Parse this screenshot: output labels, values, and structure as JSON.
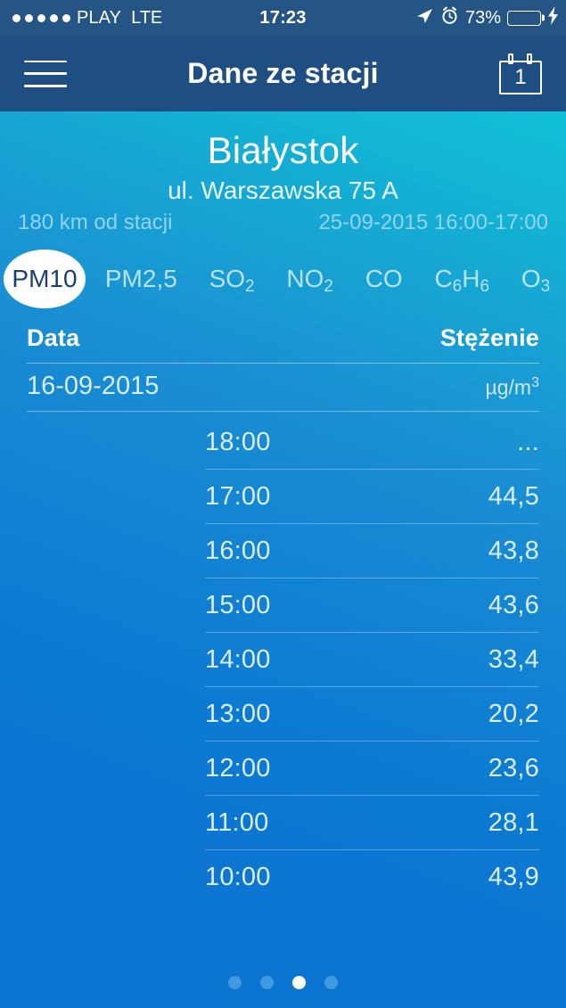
{
  "status_bar": {
    "signal_dots": 5,
    "carrier": "PLAY",
    "network": "LTE",
    "time": "17:23",
    "location_icon": "location-arrow-icon",
    "alarm_icon": "alarm-clock-icon",
    "battery_percent": "73%",
    "battery_level": 73,
    "battery_color": "#4cd964",
    "charging_icon": "lightning-bolt-icon"
  },
  "navbar": {
    "menu_icon": "hamburger-menu-icon",
    "title": "Dane ze stacji",
    "calendar_icon": "calendar-icon",
    "calendar_day": "1",
    "background": "#1f4f82"
  },
  "station": {
    "city": "Białystok",
    "address": "ul. Warszawska 75 A",
    "distance": "180 km od stacji",
    "period": "25-09-2015 16:00-17:00"
  },
  "pollutant_tabs": {
    "selected": "PM10",
    "items": [
      {
        "label": "PM10",
        "base": "PM10",
        "sub": "",
        "active": true
      },
      {
        "label": "PM2,5",
        "base": "PM2,5",
        "sub": "",
        "active": false
      },
      {
        "label": "SO2",
        "base": "SO",
        "sub": "2",
        "active": false
      },
      {
        "label": "NO2",
        "base": "NO",
        "sub": "2",
        "active": false
      },
      {
        "label": "CO",
        "base": "CO",
        "sub": "",
        "active": false
      },
      {
        "label": "C6H6",
        "base": "C",
        "sub": "6",
        "active": false
      },
      {
        "label": "O3",
        "base": "O",
        "sub": "3",
        "active": false
      }
    ]
  },
  "table": {
    "header_date": "Data",
    "header_value": "Stężenie",
    "sub_date": "16-09-2015",
    "sub_unit_base": "µg/m",
    "sub_unit_sup": "3",
    "rows": [
      {
        "time": "18:00",
        "value": "..."
      },
      {
        "time": "17:00",
        "value": "44,5"
      },
      {
        "time": "16:00",
        "value": "43,8"
      },
      {
        "time": "15:00",
        "value": "43,6"
      },
      {
        "time": "14:00",
        "value": "33,4"
      },
      {
        "time": "13:00",
        "value": "20,2"
      },
      {
        "time": "12:00",
        "value": "23,6"
      },
      {
        "time": "11:00",
        "value": "28,1"
      },
      {
        "time": "10:00",
        "value": "43,9"
      }
    ]
  },
  "pager": {
    "count": 4,
    "active_index": 2
  },
  "colors": {
    "statusbar": "#255584",
    "navbar": "#1f4f82",
    "gradient_top_right": "#12bcd4",
    "gradient_bottom": "#0c76d2",
    "accent_white": "#ffffff"
  }
}
